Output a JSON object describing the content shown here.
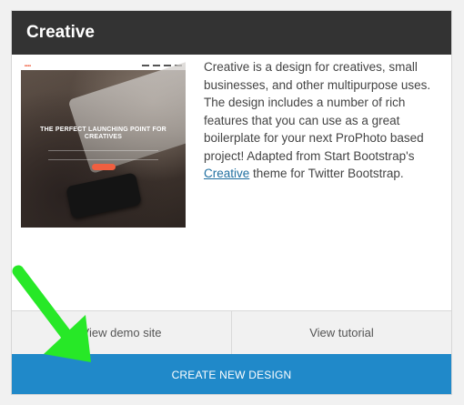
{
  "card": {
    "title": "Creative",
    "description_before_link": "Creative is a design for creatives, small businesses, and other multipurpose uses. The design includes a number of rich features that you can use as a great boilerplate for your next ProPhoto based project! Adapted from Start Bootstrap's ",
    "description_link": "Creative",
    "description_after_link": " theme for Twitter Bootstrap.",
    "preview": {
      "hero_title": "THE PERFECT LAUNCHING POINT FOR CREATIVES"
    },
    "view_demo_label": "View demo site",
    "view_tutorial_label": "View tutorial",
    "create_label": "CREATE NEW DESIGN"
  },
  "colors": {
    "header_bg": "#333333",
    "create_bg": "#2089c9",
    "link": "#1f6fa0",
    "annotation_arrow": "#27e827"
  },
  "icons": {
    "annotation": "green-arrow-icon"
  }
}
